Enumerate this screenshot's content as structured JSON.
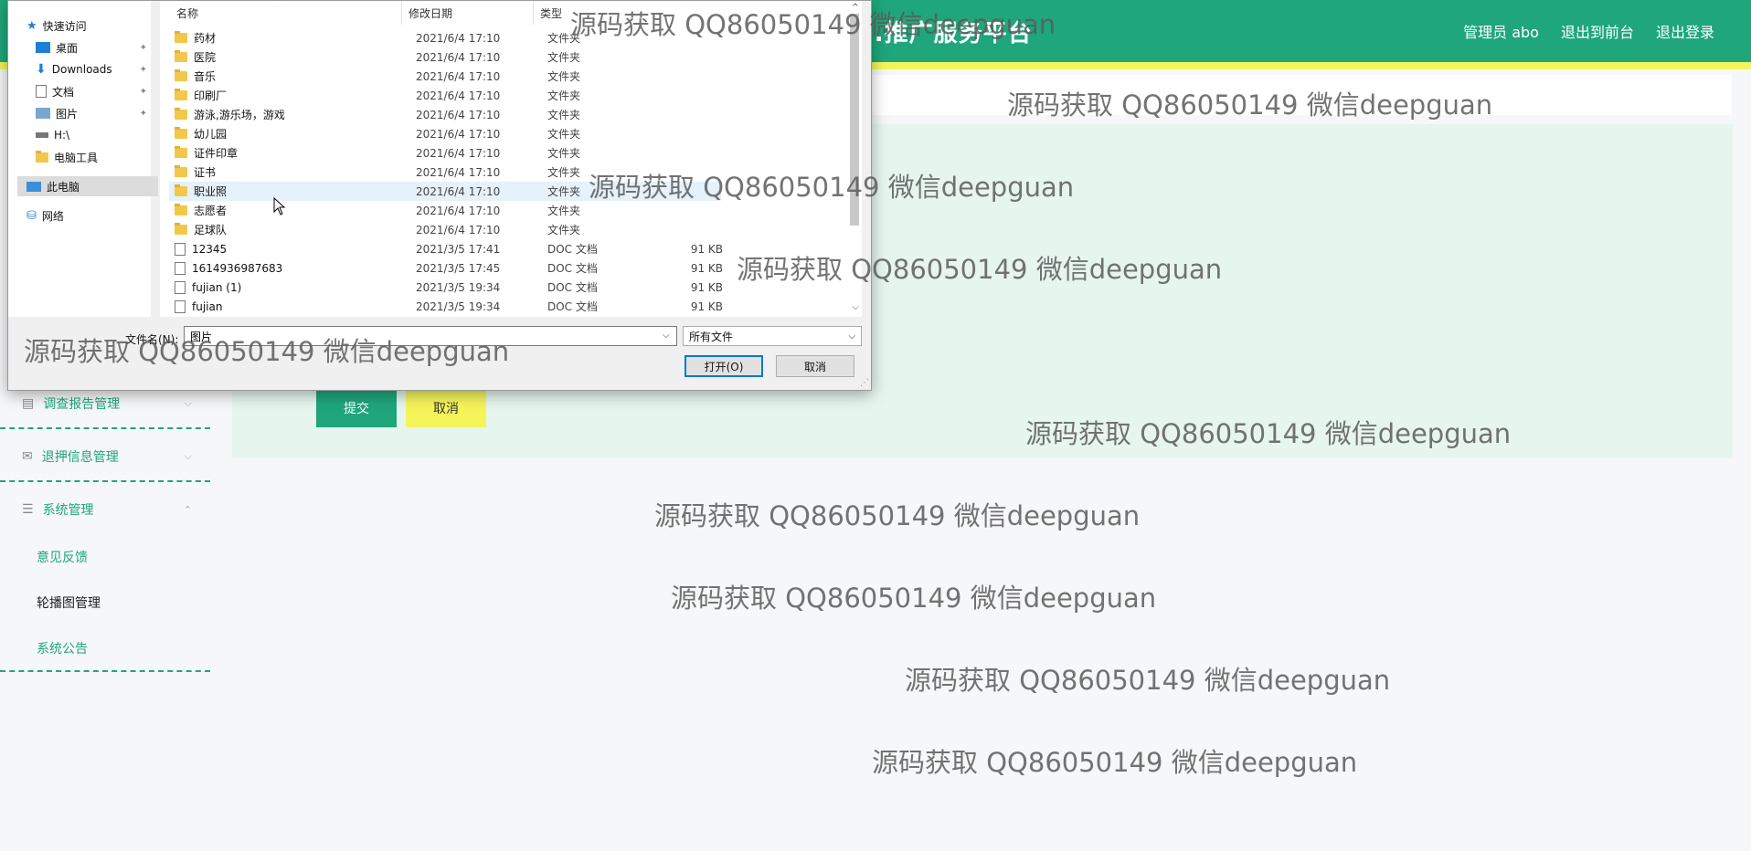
{
  "app": {
    "site_title": "...推广服务平台",
    "top_links": [
      "管理员 abo",
      "退出到前台",
      "退出登录"
    ],
    "colors": {
      "primary": "#1fa67a",
      "accent": "#f5f55a",
      "panel": "#e6f6ef"
    }
  },
  "sidebar": {
    "groups": [
      {
        "label": "调查报告管理",
        "icon": "chat-icon",
        "expanded": false
      },
      {
        "label": "退押信息管理",
        "icon": "mail-icon",
        "expanded": false
      },
      {
        "label": "系统管理",
        "icon": "sliders-icon",
        "expanded": true
      }
    ],
    "sub_items": [
      "意见反馈",
      "轮播图管理",
      "系统公告"
    ],
    "active_sub_item": "轮播图管理"
  },
  "form": {
    "submit_label": "提交",
    "cancel_label": "取消"
  },
  "dialog": {
    "nav": [
      {
        "label": "快速访问",
        "icon": "star-icon"
      },
      {
        "label": "桌面",
        "icon": "desktop-icon",
        "pinned": true
      },
      {
        "label": "Downloads",
        "icon": "download-icon",
        "pinned": true
      },
      {
        "label": "文档",
        "icon": "document-icon",
        "pinned": true
      },
      {
        "label": "图片",
        "icon": "picture-icon",
        "pinned": true
      },
      {
        "label": "H:\\",
        "icon": "drive-icon"
      },
      {
        "label": "电脑工具",
        "icon": "folder-icon"
      },
      {
        "label": "此电脑",
        "icon": "computer-icon",
        "selected": true
      },
      {
        "label": "网络",
        "icon": "network-icon"
      }
    ],
    "columns": {
      "name": "名称",
      "date": "修改日期",
      "type": "类型"
    },
    "files": [
      {
        "name": "药材",
        "date": "2021/6/4 17:10",
        "type": "文件夹",
        "size": "",
        "kind": "folder"
      },
      {
        "name": "医院",
        "date": "2021/6/4 17:10",
        "type": "文件夹",
        "size": "",
        "kind": "folder"
      },
      {
        "name": "音乐",
        "date": "2021/6/4 17:10",
        "type": "文件夹",
        "size": "",
        "kind": "folder"
      },
      {
        "name": "印刷厂",
        "date": "2021/6/4 17:10",
        "type": "文件夹",
        "size": "",
        "kind": "folder"
      },
      {
        "name": "游泳,游乐场，游戏",
        "date": "2021/6/4 17:10",
        "type": "文件夹",
        "size": "",
        "kind": "folder"
      },
      {
        "name": "幼儿园",
        "date": "2021/6/4 17:10",
        "type": "文件夹",
        "size": "",
        "kind": "folder"
      },
      {
        "name": "证件印章",
        "date": "2021/6/4 17:10",
        "type": "文件夹",
        "size": "",
        "kind": "folder"
      },
      {
        "name": "证书",
        "date": "2021/6/4 17:10",
        "type": "文件夹",
        "size": "",
        "kind": "folder"
      },
      {
        "name": "职业照",
        "date": "2021/6/4 17:10",
        "type": "文件夹",
        "size": "",
        "kind": "folder",
        "hover": true
      },
      {
        "name": "志愿者",
        "date": "2021/6/4 17:10",
        "type": "文件夹",
        "size": "",
        "kind": "folder"
      },
      {
        "name": "足球队",
        "date": "2021/6/4 17:10",
        "type": "文件夹",
        "size": "",
        "kind": "folder"
      },
      {
        "name": "12345",
        "date": "2021/3/5 17:41",
        "type": "DOC 文档",
        "size": "91 KB",
        "kind": "doc"
      },
      {
        "name": "1614936987683",
        "date": "2021/3/5 17:45",
        "type": "DOC 文档",
        "size": "91 KB",
        "kind": "doc"
      },
      {
        "name": "fujian (1)",
        "date": "2021/3/5 19:34",
        "type": "DOC 文档",
        "size": "91 KB",
        "kind": "doc"
      },
      {
        "name": "fujian",
        "date": "2021/3/5 19:34",
        "type": "DOC 文档",
        "size": "91 KB",
        "kind": "doc"
      }
    ],
    "filename_label": "文件名(N):",
    "filename_value": "图片",
    "filetype_value": "所有文件",
    "open_label": "打开(O)",
    "cancel_label": "取消"
  },
  "watermark": "源码获取 QQ86050149 微信deepguan"
}
